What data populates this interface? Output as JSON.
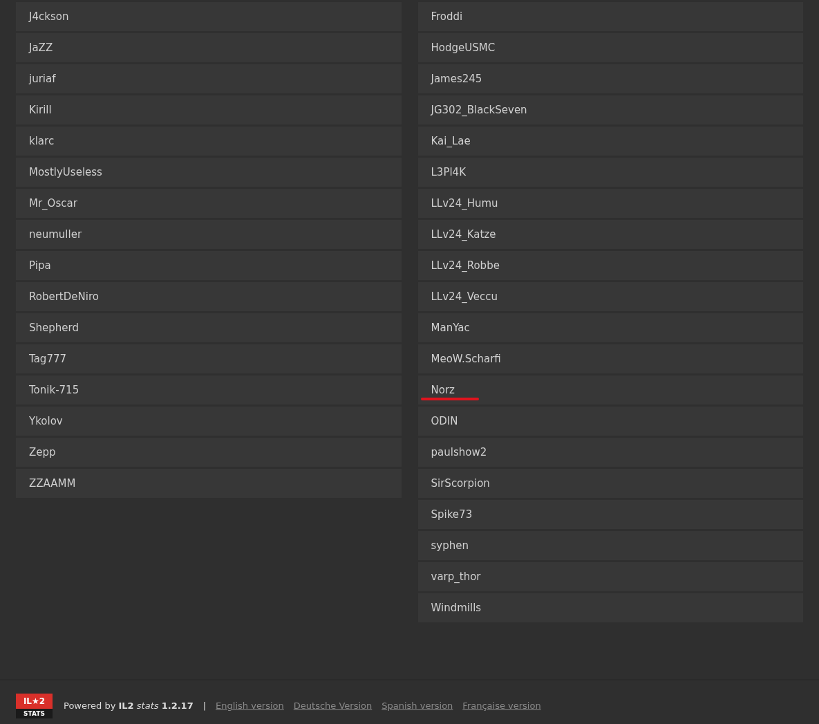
{
  "columns": [
    {
      "players": [
        {
          "name": "J4ckson",
          "marked": false
        },
        {
          "name": "JaZZ",
          "marked": false
        },
        {
          "name": "juriaf",
          "marked": false
        },
        {
          "name": "Kirill",
          "marked": false
        },
        {
          "name": "klarc",
          "marked": false
        },
        {
          "name": "MostlyUseless",
          "marked": false
        },
        {
          "name": "Mr_Oscar",
          "marked": false
        },
        {
          "name": "neumuller",
          "marked": false
        },
        {
          "name": "Pipa",
          "marked": false
        },
        {
          "name": "RobertDeNiro",
          "marked": false
        },
        {
          "name": "Shepherd",
          "marked": false
        },
        {
          "name": "Tag777",
          "marked": false
        },
        {
          "name": "Tonik-715",
          "marked": false
        },
        {
          "name": "Ykolov",
          "marked": false
        },
        {
          "name": "Zepp",
          "marked": false
        },
        {
          "name": "ZZAAMM",
          "marked": false
        }
      ]
    },
    {
      "players": [
        {
          "name": "Froddi",
          "marked": false
        },
        {
          "name": "HodgeUSMC",
          "marked": false
        },
        {
          "name": "James245",
          "marked": false
        },
        {
          "name": "JG302_BlackSeven",
          "marked": false
        },
        {
          "name": "Kai_Lae",
          "marked": false
        },
        {
          "name": "L3Pl4K",
          "marked": false
        },
        {
          "name": "LLv24_Humu",
          "marked": false
        },
        {
          "name": "LLv24_Katze",
          "marked": false
        },
        {
          "name": "LLv24_Robbe",
          "marked": false
        },
        {
          "name": "LLv24_Veccu",
          "marked": false
        },
        {
          "name": "ManYac",
          "marked": false
        },
        {
          "name": "MeoW.Scharfi",
          "marked": false
        },
        {
          "name": "Norz",
          "marked": true
        },
        {
          "name": "ODIN",
          "marked": false
        },
        {
          "name": "paulshow2",
          "marked": false
        },
        {
          "name": "SirScorpion",
          "marked": false
        },
        {
          "name": "Spike73",
          "marked": false
        },
        {
          "name": "syphen",
          "marked": false
        },
        {
          "name": "varp_thor",
          "marked": false
        },
        {
          "name": "Windmills",
          "marked": false
        }
      ]
    }
  ],
  "footer": {
    "logo": {
      "top": "IL★2",
      "bottom": "STATS"
    },
    "powered": "Powered by **IL2** *stats* **1.2.17**",
    "separator": "|",
    "links": [
      "English version",
      "Deutsche Version",
      "Spanish version",
      "Française version"
    ]
  }
}
